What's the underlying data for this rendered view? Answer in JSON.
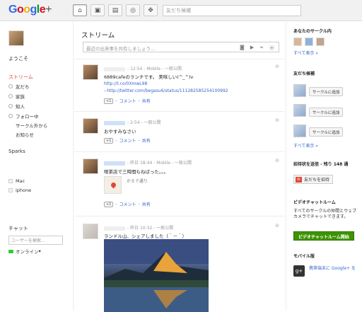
{
  "header": {
    "logo": "Google+",
    "search_placeholder": "友だち候補"
  },
  "left": {
    "welcome": "ようこそ",
    "stream": "ストリーム",
    "circles": [
      "友だち",
      "家族",
      "知人",
      "フォロー中",
      "サークル外から",
      "お知らせ"
    ],
    "sparks_title": "Sparks",
    "sparks": [
      "Mac",
      "iphone"
    ],
    "chat_title": "チャット",
    "chat_search_placeholder": "ユーザーを検索...",
    "online_label": "オンライン"
  },
  "main": {
    "title": "ストリーム",
    "share_placeholder": "最近の出来事を共有しましょう...",
    "posts": [
      {
        "meta": "- 12:54 - Mobile - 一般公開",
        "text": "6889cafeのランチです。 美味しい(^_^)v",
        "links": [
          "http://t.co/0XmwL98",
          "--http://twitter.com/begasu6/status/111282585254100992"
        ],
        "actions": [
          "コメント",
          "共有"
        ]
      },
      {
        "meta": "- 2:54 - 一般公開",
        "text": "おやすみなさい",
        "actions": [
          "コメント",
          "共有"
        ]
      },
      {
        "meta": "- 昨日 18:44 - Mobile - 一般公開",
        "text": "喫茶店で三時間もねばった。。。",
        "map_caption": "かえで通り",
        "actions": [
          "コメント",
          "共有"
        ]
      },
      {
        "meta": "- 昨日 10:32 - 一般公開",
        "text": "ランドル山、シェアしました（＾－＾）"
      }
    ],
    "plusone": "+1"
  },
  "right": {
    "circles_title": "あなたのサークル内",
    "show_all": "すべて表示 »",
    "suggestions_title": "友だち候補",
    "add_button": "サークルに追加",
    "invite_title": "招待状を送信 - 残り 148 通",
    "invite_button": "友だちを招待",
    "video_title": "ビデオチャットルーム",
    "video_text": "すべてのサークルの仲間とウェブカメラでチャットできます。",
    "video_button": "ビデオチャットルーム開始",
    "mobile_title": "モバイル版",
    "mobile_link": "携帯端末に Google+ を"
  }
}
